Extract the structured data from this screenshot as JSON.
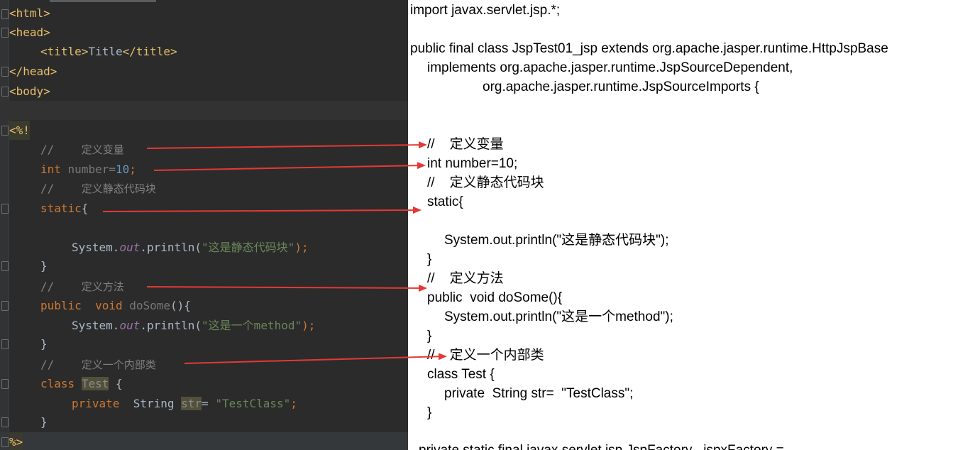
{
  "editor": {
    "lines": {
      "html_open": "<html>",
      "head_open": "<head>",
      "title_open": "<title>",
      "title_text": "Title",
      "title_close": "</title>",
      "head_close": "</head>",
      "body_open": "<body>",
      "decl_open": "<%!",
      "comment_slashes": "//",
      "comment_define_var": "定义变量",
      "kw_int": "int",
      "var_decl": "number=",
      "number_value": "10",
      "semicolon": ";",
      "comment_define_static": "定义静态代码块",
      "kw_static": "static",
      "brace_open": "{",
      "system": "System.",
      "out": "out",
      "println": ".println(",
      "str_static_block": "\"这是静态代码块\"",
      "close_call": ");",
      "brace_close": "}",
      "comment_define_method": "定义方法",
      "kw_public": "public",
      "kw_void": "void",
      "method_name": "doSome",
      "parens_brace": "(){",
      "str_method": "\"这是一个method\"",
      "comment_define_inner": "定义一个内部类",
      "kw_class": "class",
      "class_name": "Test",
      "kw_private": "private",
      "type_string": "String",
      "field_name": "str",
      "assign": "=",
      "str_testclass": "\"TestClass\"",
      "decl_close": "%>"
    }
  },
  "source": {
    "lines": [
      "import javax.servlet.jsp.*;",
      "public final class JspTest01_jsp extends org.apache.jasper.runtime.HttpJspBase",
      "implements org.apache.jasper.runtime.JspSourceDependent,",
      "org.apache.jasper.runtime.JspSourceImports {",
      "//    定义变量",
      "int number=10;",
      "//    定义静态代码块",
      "static{",
      "System.out.println(\"这是静态代码块\");",
      "}",
      "//    定义方法",
      "public  void doSome(){",
      "System.out.println(\"这是一个method\");",
      "}",
      "//    定义一个内部类",
      "class Test {",
      "private  String str=  \"TestClass\";",
      "}",
      "private static final javax.servlet.jsp.JspFactory _jspxFactory ="
    ]
  },
  "colors": {
    "arrow": "#e53935",
    "editor_bg": "#2b2b2b",
    "source_bg": "#ffffff"
  }
}
